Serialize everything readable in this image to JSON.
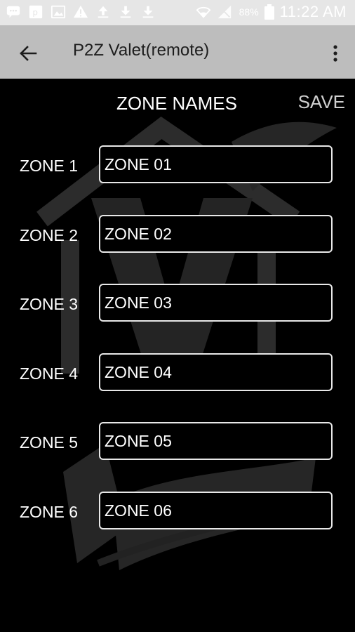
{
  "status_bar": {
    "battery_percent": "88%",
    "time": "11:22 AM",
    "icons": [
      "message-icon",
      "photo-icon",
      "gallery-icon",
      "warning-icon",
      "upload-icon",
      "download-icon",
      "download-icon",
      "wifi-icon",
      "signal-icon",
      "battery-icon"
    ]
  },
  "app_bar": {
    "title": "P2Z Valet(remote)",
    "back_icon": "arrow-left-icon",
    "menu_icon": "more-vert-icon"
  },
  "header": {
    "title": "ZONE NAMES",
    "save_label": "SAVE"
  },
  "zones": [
    {
      "label": "ZONE 1",
      "value": "ZONE 01"
    },
    {
      "label": "ZONE 2",
      "value": "ZONE 02"
    },
    {
      "label": "ZONE 3",
      "value": "ZONE 03"
    },
    {
      "label": "ZONE 4",
      "value": "ZONE 04"
    },
    {
      "label": "ZONE 5",
      "value": "ZONE 05"
    },
    {
      "label": "ZONE 6",
      "value": "ZONE 06"
    }
  ],
  "colors": {
    "status_bar": "#e6e6e6",
    "app_bar": "#bdbdbd",
    "background": "#000000",
    "text": "#ffffff",
    "save": "#cfcfcf"
  }
}
